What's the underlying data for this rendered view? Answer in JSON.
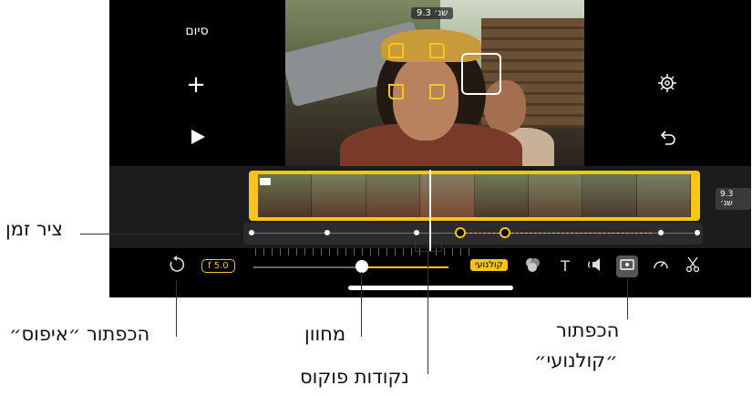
{
  "sidebar": {
    "done_label": "סיום",
    "add_glyph": "+"
  },
  "video": {
    "duration_badge": "9.3 שנ׳"
  },
  "timeline": {
    "duration_label": "9.3 שנ׳"
  },
  "toolbar": {
    "aperture_label": "f 5.0",
    "cinematic_label": "קולנועי"
  },
  "icons": [
    "reset-icon",
    "play-icon",
    "settings-icon",
    "undo-icon",
    "filters-icon",
    "text-icon",
    "audio-icon",
    "cinematic-icon",
    "speed-icon",
    "scissors-icon",
    "camera-icon"
  ],
  "colors": {
    "accent": "#f5c518",
    "background": "#000000"
  },
  "callouts": {
    "timeline": "ציר זמן",
    "reset": "הכפתור ״איפוס״",
    "slider": "מחוון",
    "focus_points": "נקודות פוקוס",
    "cinematic_line1": "הכפתור",
    "cinematic_line2": "״קולנועי״"
  }
}
